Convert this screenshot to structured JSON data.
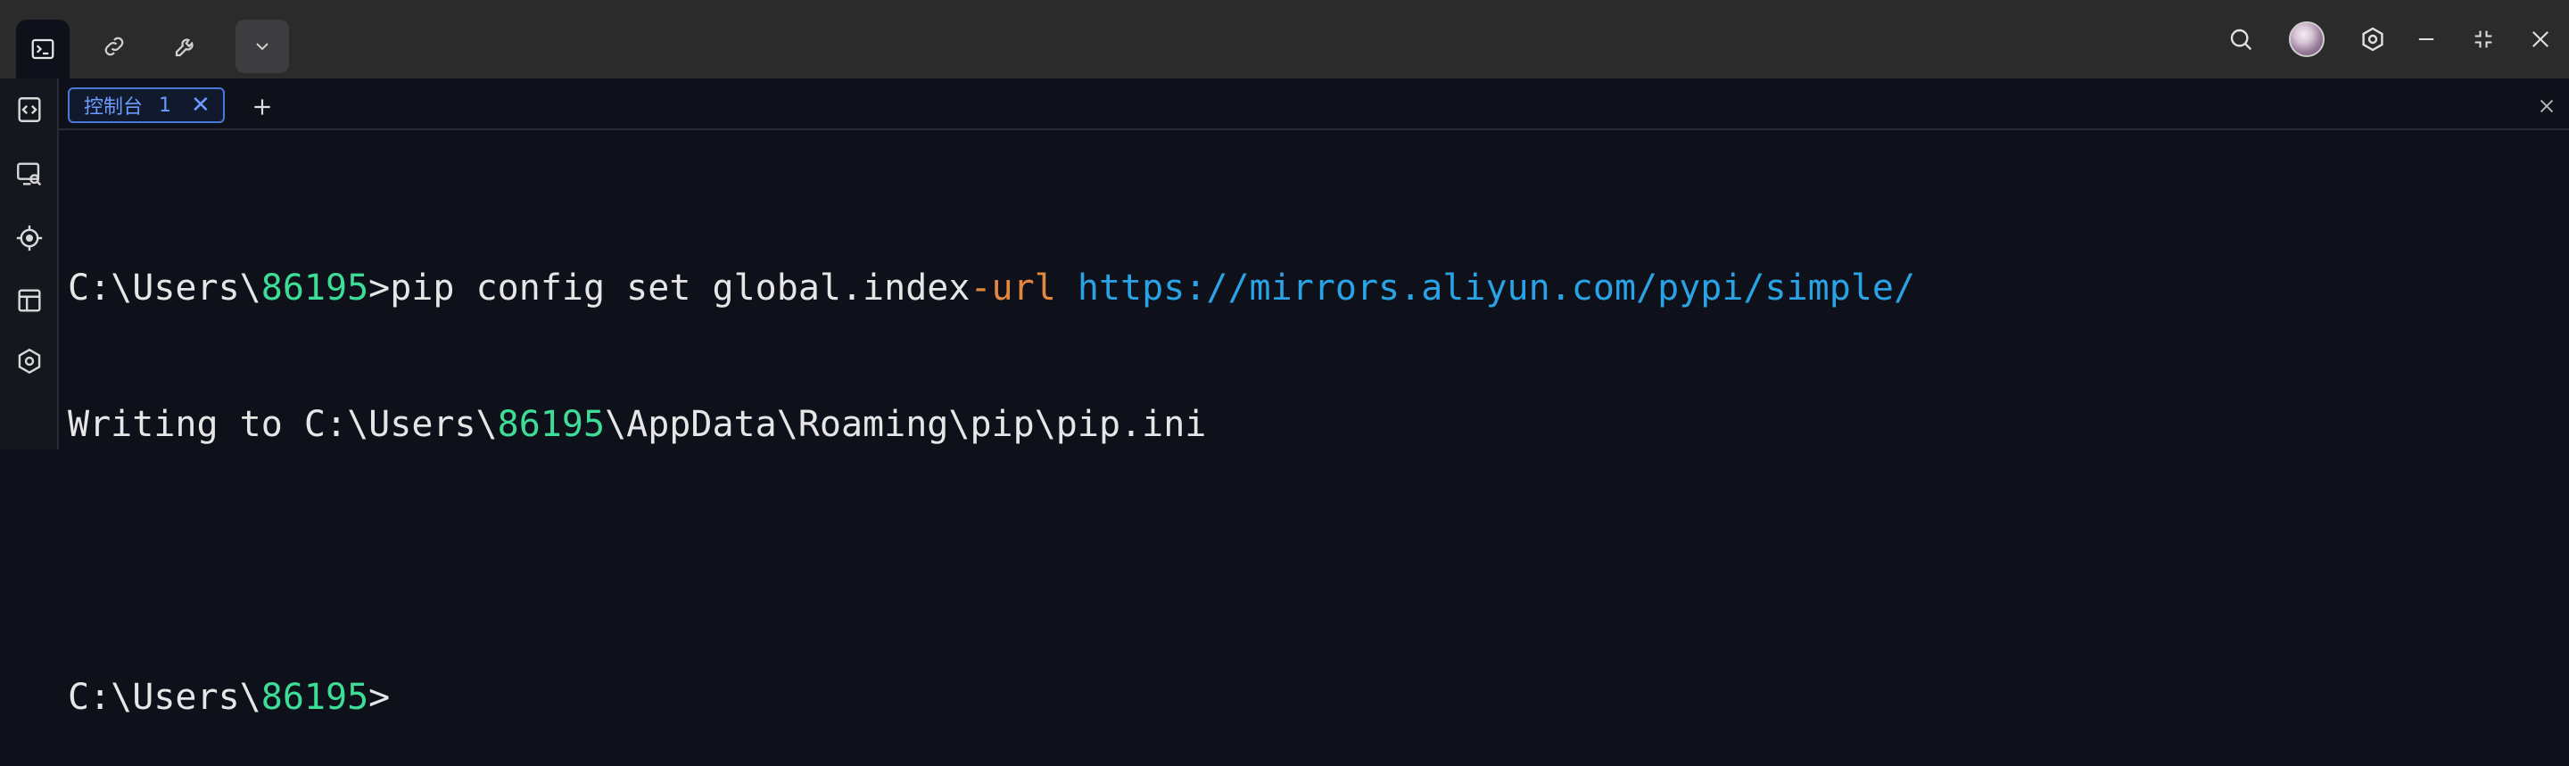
{
  "titlebar": {
    "tabs": [
      {
        "icon": "terminal-icon"
      },
      {
        "icon": "link-icon"
      },
      {
        "icon": "wrench-icon"
      },
      {
        "icon": "chevron-down-icon"
      }
    ],
    "controls": [
      "search-icon",
      "avatar",
      "settings-icon",
      "minimize-icon",
      "restore-icon",
      "close-icon"
    ]
  },
  "sidebar": {
    "items": [
      "code-icon",
      "screen-search-icon",
      "target-icon",
      "layout-icon",
      "hexagon-icon"
    ]
  },
  "console": {
    "tab_label": "控制台",
    "tab_number": "1",
    "tab_close": "✕",
    "add_tab": "+",
    "panel_close": "✕"
  },
  "terminal": {
    "line1": {
      "prefix": "C:\\Users\\",
      "user": "86195",
      "cmd": ">pip config set global.index",
      "opt": "-url",
      "url": "https://mirrors.aliyun.com/pypi/simple/"
    },
    "line2": {
      "prefix": "Writing to C:\\Users\\",
      "user": "86195",
      "rest": "\\AppData\\Roaming\\pip\\pip.ini"
    },
    "line4": {
      "prefix": "C:\\Users\\",
      "user": "86195",
      "rest": ">"
    }
  },
  "colors": {
    "background": "#0f111a",
    "titlebar": "#2b2b2b",
    "green": "#3ddc97",
    "orange": "#e3873f",
    "blue": "#2aa3e6",
    "accent": "#4a7ad9"
  }
}
